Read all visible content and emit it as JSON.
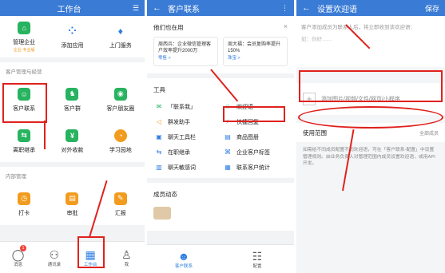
{
  "panel1": {
    "title": "工作台",
    "menu_icon": "settings-icon",
    "apps_top": [
      {
        "label": "管理企业",
        "sub": "企业·专业版",
        "icon": "company-icon",
        "color": "#27b35f"
      },
      {
        "label": "添加应用",
        "icon": "add-app-icon",
        "color": "#2f7de1"
      },
      {
        "label": "上门服务",
        "icon": "tie-icon",
        "color": "#2f7de1"
      }
    ],
    "section_customer": "客户管理与经营",
    "apps_customer": [
      {
        "label": "客户联系",
        "glyph": "☺"
      },
      {
        "label": "客户群",
        "glyph": "♞"
      },
      {
        "label": "客户朋友圈",
        "glyph": "◉"
      },
      {
        "label": "离职继承",
        "glyph": "⇆"
      },
      {
        "label": "对外收款",
        "glyph": "¥"
      },
      {
        "label": "学习园地",
        "glyph": "◔"
      }
    ],
    "section_internal": "内部管理",
    "apps_internal": [
      {
        "label": "打卡",
        "glyph": "◷"
      },
      {
        "label": "审批",
        "glyph": "▤"
      },
      {
        "label": "汇报",
        "glyph": "✎"
      }
    ],
    "tabs": [
      {
        "label": "消息",
        "icon": "message-icon",
        "glyph": "◯",
        "badge": "1"
      },
      {
        "label": "通讯录",
        "icon": "contacts-icon",
        "glyph": "⚇"
      },
      {
        "label": "工作台",
        "icon": "workbench-icon",
        "glyph": "▦"
      },
      {
        "label": "我",
        "icon": "me-icon",
        "glyph": "♙"
      }
    ]
  },
  "panel2": {
    "title": "客户联系",
    "back": "←",
    "more": "⋮",
    "others_title": "他们也在用",
    "close": "×",
    "ads": [
      {
        "text": "周西兵：企业微信管理客户效率提升2000万",
        "tag": "零售 >"
      },
      {
        "text": "周大福：会员复购率提升150%",
        "tag": "珠宝 >"
      }
    ],
    "tools_title": "工具",
    "tools": [
      {
        "label": "「联系我」",
        "icon": "contact-me-icon",
        "glyph": "✉",
        "c": "g"
      },
      {
        "label": "欢迎语",
        "icon": "welcome-icon",
        "glyph": "☺",
        "c": "g"
      },
      {
        "label": "群发助手",
        "icon": "broadcast-icon",
        "glyph": "◁",
        "c": "o"
      },
      {
        "label": "快捷回复",
        "icon": "quick-reply-icon",
        "glyph": "⚡",
        "c": ""
      },
      {
        "label": "聊天工具栏",
        "icon": "chat-toolbar-icon",
        "glyph": "▣",
        "c": ""
      },
      {
        "label": "商品图册",
        "icon": "catalog-icon",
        "glyph": "▤",
        "c": ""
      },
      {
        "label": "在职继承",
        "icon": "inherit-icon",
        "glyph": "⇆",
        "c": ""
      },
      {
        "label": "企业客户标签",
        "icon": "tag-icon",
        "glyph": "⌘",
        "c": ""
      },
      {
        "label": "聊天敏感词",
        "icon": "sensitive-icon",
        "glyph": "▥",
        "c": ""
      },
      {
        "label": "联系客户统计",
        "icon": "stats-icon",
        "glyph": "▦",
        "c": ""
      }
    ],
    "dynamics_title": "成员动态",
    "tabs": [
      {
        "label": "客户联系",
        "icon": "customer-contact-icon",
        "glyph": "☻"
      },
      {
        "label": "配置",
        "icon": "config-icon",
        "glyph": "☷"
      }
    ]
  },
  "panel3": {
    "title": "设置欢迎语",
    "back": "←",
    "save": "保存",
    "hint": "客户添加成员为联系人后，将立即收到该欢迎语：",
    "placeholder": "如：你好……",
    "attach_label": "添加图片/视频/文件/网页/小程序",
    "scope_label": "使用范围",
    "scope_value": "全部成员",
    "note": "如需给不同成员配置不同欢迎语，可在「客户联系-配置」中设置管理规则。由业务负责人对管理范围内成员设置欢迎语，或用API开发。"
  }
}
